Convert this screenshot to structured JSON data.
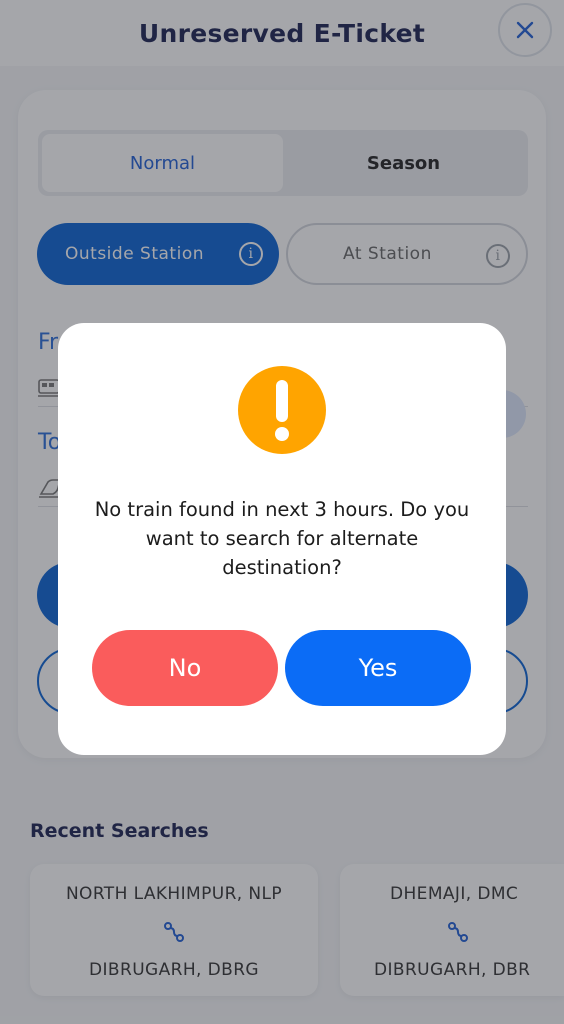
{
  "header": {
    "title": "Unreserved E-Ticket"
  },
  "ticket_type_tabs": [
    {
      "label": "Normal",
      "active": true
    },
    {
      "label": "Season",
      "active": false
    }
  ],
  "booking_location": {
    "outside_label": "Outside Station",
    "at_label": "At Station",
    "info_glyph": "i"
  },
  "form": {
    "from_label": "Fr",
    "to_label": "To"
  },
  "recent": {
    "title": "Recent Searches",
    "items": [
      {
        "from": "NORTH LAKHIMPUR, NLP",
        "to": "DIBRUGARH, DBRG"
      },
      {
        "from": "DHEMAJI, DMC",
        "to": "DIBRUGARH, DBR"
      }
    ]
  },
  "dialog": {
    "message": "No train found in next 3 hours. Do you want to search for alternate destination?",
    "no_label": "No",
    "yes_label": "Yes",
    "icon": "exclamation-icon"
  },
  "colors": {
    "primary": "#0a63d4",
    "warning": "#ffa400",
    "no_button": "#fa5c5c",
    "yes_button": "#0b6cf6",
    "header_text": "#1b2251"
  }
}
